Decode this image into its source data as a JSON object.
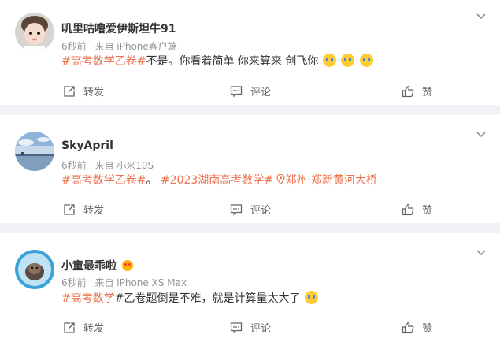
{
  "posts": [
    {
      "username": "叽里咕噜爱伊斯坦牛91",
      "time": "6秒前",
      "source": "来自 iPhone客户端",
      "tag": "#高考数学乙卷#",
      "text": "不是。你看着简单 你来算来 创飞你",
      "emoji_count": 3
    },
    {
      "username": "SkyApril",
      "time": "6秒前",
      "source": "来自 小米10S",
      "tag": "#高考数学乙卷#",
      "text": "。",
      "tag2": "#2023湖南高考数学#",
      "location": "郑州·郑新黄河大桥"
    },
    {
      "username": "小童最乖啦",
      "time": "6秒前",
      "source": "来自 iPhone XS Max",
      "tag": "#高考数学",
      "text": "#乙卷题倒是不难，就是计算量太大了",
      "emoji_count": 1
    }
  ],
  "actions": {
    "repost": "转发",
    "comment": "评论",
    "like": "赞"
  },
  "colors": {
    "tag": "#eb7350",
    "background": "#f1f2f5",
    "card": "#ffffff",
    "muted": "#939393"
  }
}
